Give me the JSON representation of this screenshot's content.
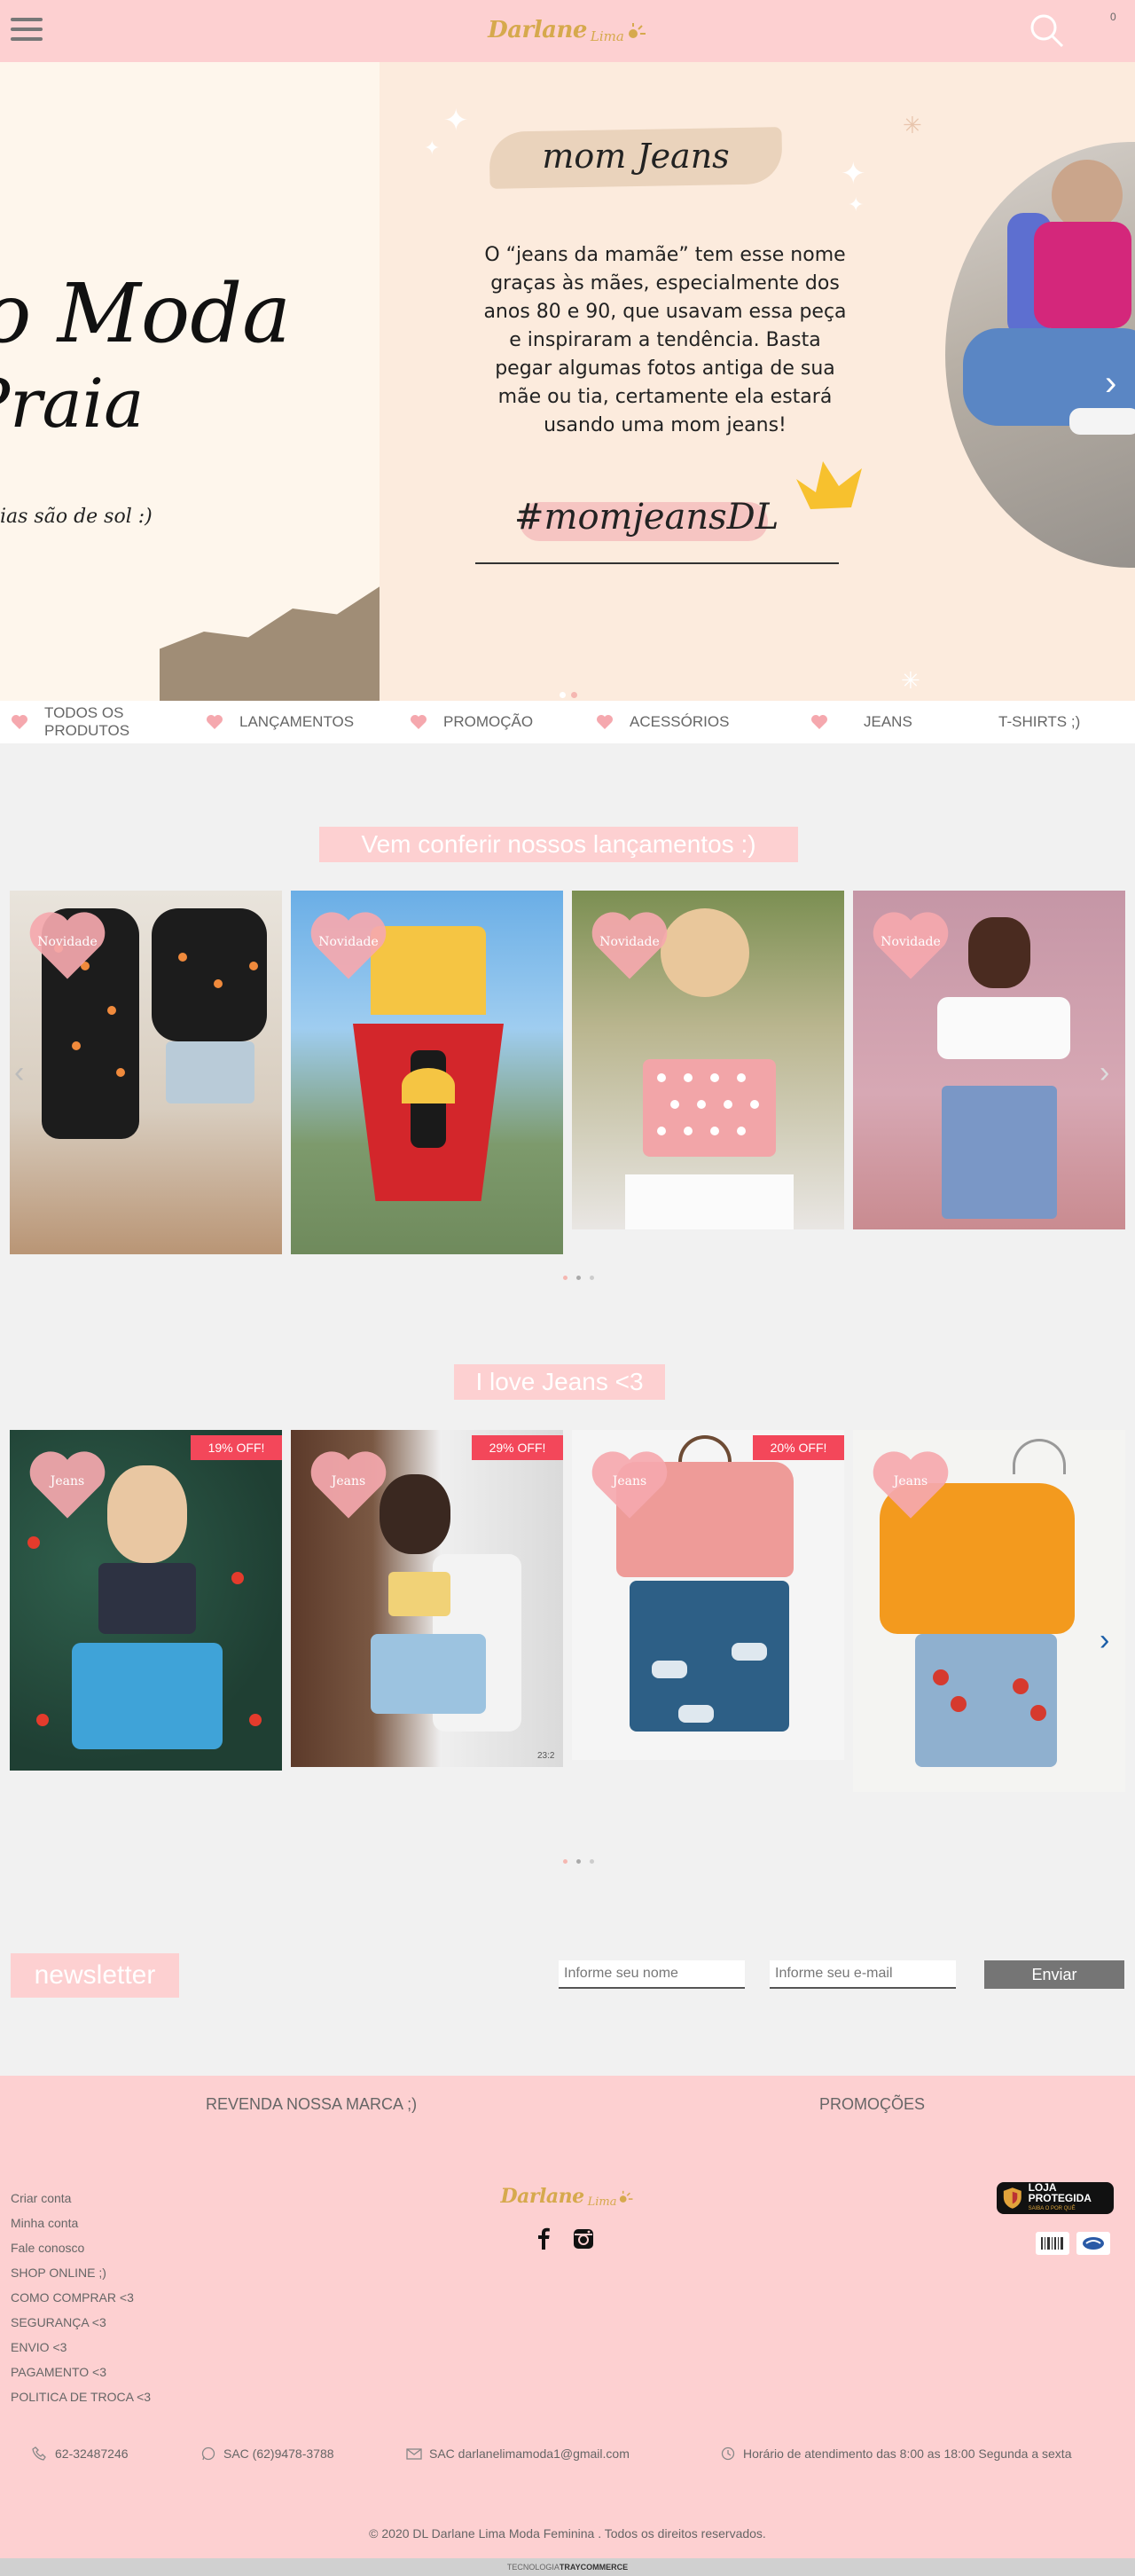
{
  "header": {
    "menu_icon": "hamburger-icon",
    "logo_main": "Darlane",
    "logo_sub": "Lima",
    "search_icon": "search-icon",
    "cart_count": "0"
  },
  "banner": {
    "left_line1": "o Moda",
    "left_line2": "Praia",
    "left_line3": "ias são de sol :)",
    "title": "mom Jeans",
    "description": "O “jeans da mamãe” tem esse nome graças às mães, especialmente dos anos 80 e 90, que usavam essa peça e inspiraram a tendência. Basta pegar algumas fotos antiga de sua mãe ou tia, certamente ela estará usando uma mom jeans!",
    "hashtag": "#momjeansDL",
    "arrow_icon": "chevron-right-icon",
    "dots_active_index": 0,
    "colors": {
      "dot_active": "#ffffff",
      "dot_inactive": "#f5b7b1"
    }
  },
  "categories": [
    {
      "label": "TODOS OS PRODUTOS",
      "icon": "heart-icon"
    },
    {
      "label": "LANÇAMENTOS",
      "icon": "heart-icon"
    },
    {
      "label": "PROMOÇÃO",
      "icon": "heart-icon"
    },
    {
      "label": "ACESSÓRIOS",
      "icon": "heart-icon"
    },
    {
      "label": "JEANS",
      "icon": "heart-icon"
    },
    {
      "label": "T-SHIRTS ;)",
      "icon": ""
    }
  ],
  "launches": {
    "title": "Vem conferir nossos lançamentos :)",
    "badge": "Novidade",
    "left_arrow_icon": "chevron-left-icon",
    "right_arrow_icon": "chevron-right-icon"
  },
  "jeans": {
    "title": "I love Jeans <3",
    "badge": "Jeans",
    "discounts": [
      "19% OFF!",
      "29% OFF!",
      "20% OFF!"
    ],
    "right_arrow_icon": "chevron-right-icon",
    "card2_caption": "23:2"
  },
  "newsletter": {
    "title": "newsletter",
    "name_placeholder": "Informe seu nome",
    "email_placeholder": "Informe seu e-mail",
    "submit_label": "Enviar"
  },
  "footer": {
    "head_left": "REVENDA NOSSA MARCA ;)",
    "head_right": "PROMOÇÕES",
    "links": [
      "Criar conta",
      "Minha conta",
      "Fale conosco",
      "SHOP ONLINE ;)",
      "COMO COMPRAR <3",
      "SEGURANÇA <3",
      "ENVIO <3",
      "PAGAMENTO <3",
      "POLITICA DE TROCA <3"
    ],
    "logo_main": "Darlane",
    "logo_sub": "Lima",
    "secure_title": "LOJA PROTEGIDA",
    "secure_sub": "SAIBA O POR QUÊ",
    "phone": "62-32487246",
    "whatsapp": "SAC (62)9478-3788",
    "email": "SAC darlanelimamoda1@gmail.com",
    "hours": "Horário de atendimento das 8:00 as 18:00 Segunda a sexta",
    "copyright": "© 2020 DL Darlane Lima Moda Feminina . Todos os direitos reservados.",
    "tech_prefix": "TECNOLOGIA",
    "tech_brand": "TRAYCOMMERCE"
  },
  "colors": {
    "brand_pink": "#fdd0d1",
    "heart_pink": "#f5a8ae",
    "logo_gold": "#d6a94d",
    "discount_red": "#f3475a",
    "button_gray": "#757575",
    "arrow_blue": "#1b5ea8"
  }
}
